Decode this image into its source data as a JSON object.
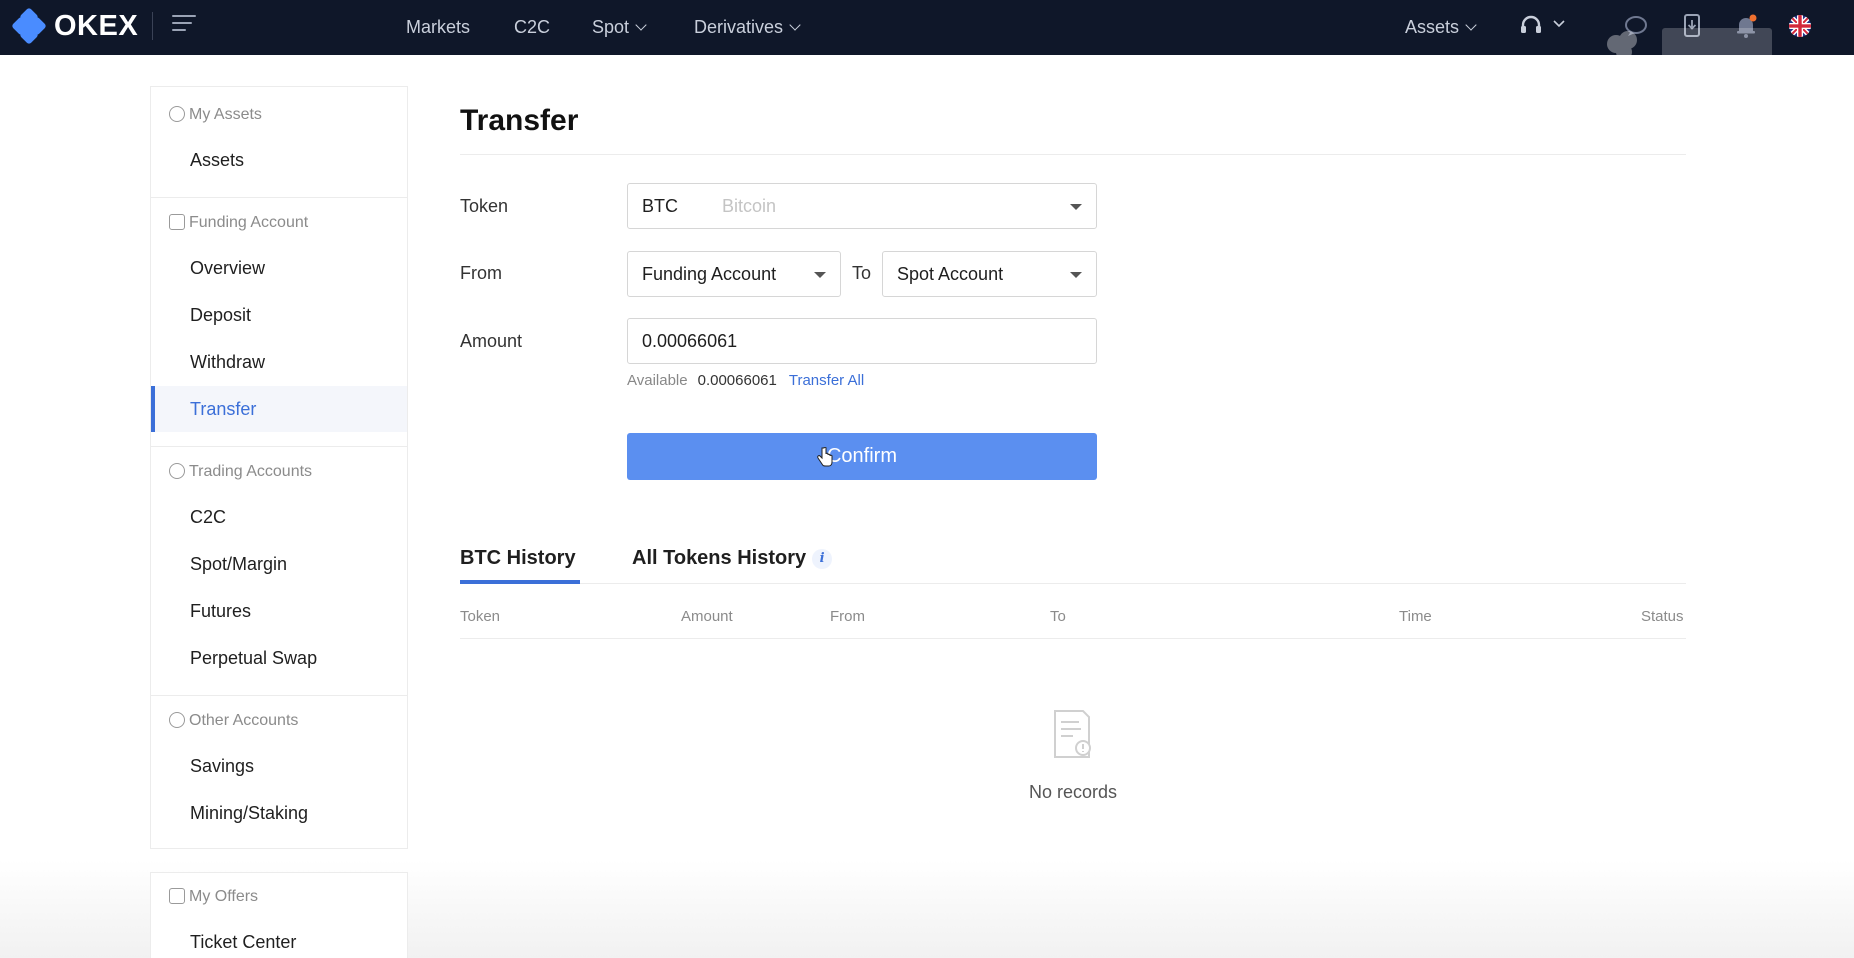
{
  "brand": {
    "name": "OKEX",
    "accent": "#3b6fd8"
  },
  "topnav": {
    "items": [
      {
        "label": "Markets"
      },
      {
        "label": "C2C"
      },
      {
        "label": "Spot"
      },
      {
        "label": "Derivatives"
      }
    ],
    "right": {
      "assets_label": "Assets"
    },
    "icons": [
      "menu-icon",
      "headset-icon",
      "chat-icon",
      "download-icon",
      "bell-icon",
      "uk-flag-icon"
    ]
  },
  "sidebar": {
    "groups": [
      {
        "label": "My Assets",
        "items": [
          "Assets"
        ]
      },
      {
        "label": "Funding Account",
        "items": [
          "Overview",
          "Deposit",
          "Withdraw",
          "Transfer"
        ]
      },
      {
        "label": "Trading Accounts",
        "items": [
          "C2C",
          "Spot/Margin",
          "Futures",
          "Perpetual Swap"
        ]
      },
      {
        "label": "Other Accounts",
        "items": [
          "Savings",
          "Mining/Staking"
        ]
      }
    ],
    "active_item": "Transfer",
    "offers": {
      "label": "My Offers",
      "items": [
        "Ticket Center"
      ]
    }
  },
  "main": {
    "title": "Transfer",
    "form": {
      "token_label": "Token",
      "token_value": "BTC",
      "token_name": "Bitcoin",
      "from_label": "From",
      "from_value": "Funding Account",
      "to_label": "To",
      "to_value": "Spot Account",
      "amount_label": "Amount",
      "amount_value": "0.00066061",
      "available_label": "Available",
      "available_value": "0.00066061",
      "transfer_all_label": "Transfer All",
      "confirm_label": "Confirm"
    },
    "history": {
      "tabs": [
        "BTC History",
        "All Tokens History"
      ],
      "active_tab": "BTC History",
      "info_glyph": "i",
      "columns": [
        "Token",
        "Amount",
        "From",
        "To",
        "Time",
        "Status"
      ],
      "rows": [],
      "empty_text": "No records"
    }
  }
}
